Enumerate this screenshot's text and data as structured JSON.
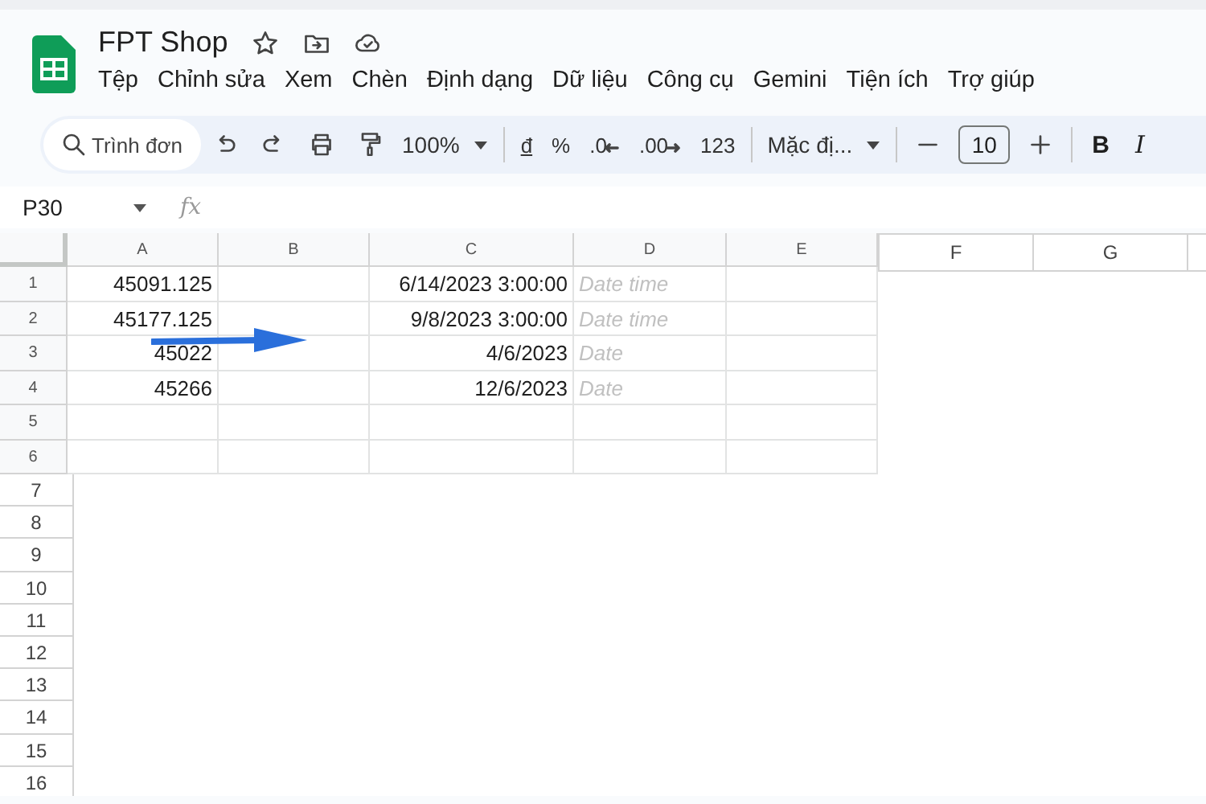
{
  "title": "FPT Shop",
  "menu": [
    "Tệp",
    "Chỉnh sửa",
    "Xem",
    "Chèn",
    "Định dạng",
    "Dữ liệu",
    "Công cụ",
    "Gemini",
    "Tiện ích",
    "Trợ giúp"
  ],
  "toolbar": {
    "search_placeholder": "Trình đơn",
    "zoom": "100%",
    "number_formats": [
      "đ",
      "%",
      ".0",
      ".00",
      "123"
    ],
    "font": "Mặc đị...",
    "font_size": "10",
    "text_styles": [
      "B",
      "I"
    ]
  },
  "name_box": "P30",
  "formula_label": "fx",
  "sheet": {
    "columns": [
      "A",
      "B",
      "C",
      "D",
      "E"
    ],
    "rows": [
      {
        "label": "1",
        "cells": [
          {
            "kind": "value",
            "text": "45091.125"
          },
          {
            "kind": "empty"
          },
          {
            "kind": "value",
            "text": "6/14/2023 3:00:00"
          },
          {
            "kind": "hint",
            "text": "Date time"
          },
          {
            "kind": "empty"
          }
        ]
      },
      {
        "label": "2",
        "cells": [
          {
            "kind": "value",
            "text": "45177.125"
          },
          {
            "kind": "empty"
          },
          {
            "kind": "value",
            "text": "9/8/2023 3:00:00"
          },
          {
            "kind": "hint",
            "text": "Date time"
          },
          {
            "kind": "empty"
          }
        ]
      },
      {
        "label": "3",
        "cells": [
          {
            "kind": "value",
            "text": "45022"
          },
          {
            "kind": "empty"
          },
          {
            "kind": "value",
            "text": "4/6/2023"
          },
          {
            "kind": "hint",
            "text": "Date"
          },
          {
            "kind": "empty"
          }
        ]
      },
      {
        "label": "4",
        "cells": [
          {
            "kind": "value",
            "text": "45266"
          },
          {
            "kind": "empty"
          },
          {
            "kind": "value",
            "text": "12/6/2023"
          },
          {
            "kind": "hint",
            "text": "Date"
          },
          {
            "kind": "empty"
          }
        ]
      },
      {
        "label": "5",
        "cells": [
          {
            "kind": "empty"
          },
          {
            "kind": "empty"
          },
          {
            "kind": "empty"
          },
          {
            "kind": "empty"
          },
          {
            "kind": "empty"
          }
        ]
      },
      {
        "label": "6",
        "cells": [
          {
            "kind": "empty"
          },
          {
            "kind": "empty"
          },
          {
            "kind": "empty"
          },
          {
            "kind": "empty"
          },
          {
            "kind": "empty"
          }
        ]
      }
    ]
  },
  "extra_columns": [
    "F",
    "G"
  ],
  "extra_rows": [
    "7",
    "8",
    "9",
    "10",
    "11",
    "12",
    "13",
    "14",
    "15",
    "16"
  ]
}
